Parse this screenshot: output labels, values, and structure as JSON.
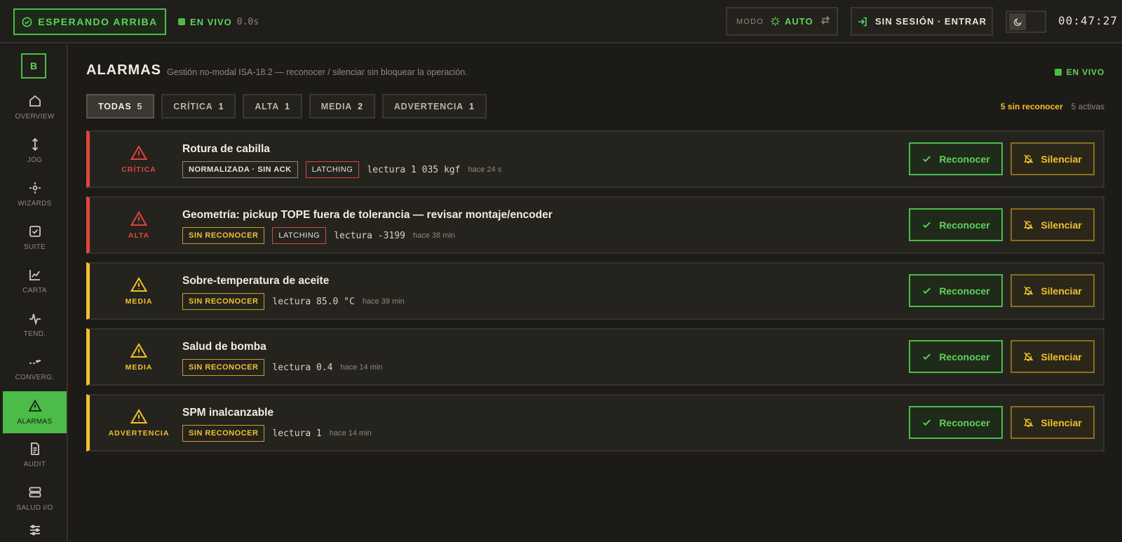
{
  "topbar": {
    "status_label": "ESPERANDO ARRIBA",
    "live_label": "EN VIVO",
    "live_time": "0.0s",
    "mode_label": "MODO",
    "mode_value": "AUTO",
    "session_label": "SIN SESIÓN · ENTRAR",
    "clock": "00:47:27"
  },
  "sidebar": {
    "logo": "B",
    "items": [
      {
        "label": "OVERVIEW",
        "icon": "home-icon"
      },
      {
        "label": "JOG",
        "icon": "vertical-arrows-icon"
      },
      {
        "label": "WIZARDS",
        "icon": "target-icon"
      },
      {
        "label": "SUITE",
        "icon": "checkbox-icon"
      },
      {
        "label": "CARTA",
        "icon": "chart-icon"
      },
      {
        "label": "TEND.",
        "icon": "pulse-icon"
      },
      {
        "label": "CONVERG.",
        "icon": "converge-icon"
      },
      {
        "label": "ALARMAS",
        "icon": "warning-icon"
      },
      {
        "label": "AUDIT",
        "icon": "document-icon"
      },
      {
        "label": "SALUD I/O",
        "icon": "server-icon"
      }
    ]
  },
  "page": {
    "title": "ALARMAS",
    "subtitle": "Gestión no-modal ISA-18.2 — reconocer / silenciar sin bloquear la operación.",
    "live_label": "EN VIVO"
  },
  "filters": [
    {
      "label": "TODAS",
      "count": "5"
    },
    {
      "label": "CRÍTICA",
      "count": "1"
    },
    {
      "label": "ALTA",
      "count": "1"
    },
    {
      "label": "MEDIA",
      "count": "2"
    },
    {
      "label": "ADVERTENCIA",
      "count": "1"
    }
  ],
  "summary": {
    "unacked": "5 sin reconocer",
    "active": "5 activas"
  },
  "actions": {
    "ack": "Reconocer",
    "silence": "Silenciar"
  },
  "alarms": [
    {
      "severity": "CRÍTICA",
      "title": "Rotura de cabilla",
      "state_tag": "NORMALIZADA · SIN ACK",
      "latch_tag": "LATCHING",
      "reading": "lectura 1 035 kgf",
      "ago": "hace 24 s"
    },
    {
      "severity": "ALTA",
      "title": "Geometría: pickup TOPE fuera de tolerancia — revisar montaje/encoder",
      "state_tag": "SIN RECONOCER",
      "latch_tag": "LATCHING",
      "reading": "lectura -3199",
      "ago": "hace 38 min"
    },
    {
      "severity": "MEDIA",
      "title": "Sobre-temperatura de aceite",
      "state_tag": "SIN RECONOCER",
      "reading": "lectura 85.0 °C",
      "ago": "hace 39 min"
    },
    {
      "severity": "MEDIA",
      "title": "Salud de bomba",
      "state_tag": "SIN RECONOCER",
      "reading": "lectura 0.4",
      "ago": "hace 14 min"
    },
    {
      "severity": "ADVERTENCIA",
      "title": "SPM inalcanzable",
      "state_tag": "SIN RECONOCER",
      "reading": "lectura 1",
      "ago": "hace 14 min"
    }
  ],
  "colors": {
    "accent_green": "#4cbb47",
    "critical_red": "#e0453a",
    "warning_yellow": "#f2c12e"
  }
}
